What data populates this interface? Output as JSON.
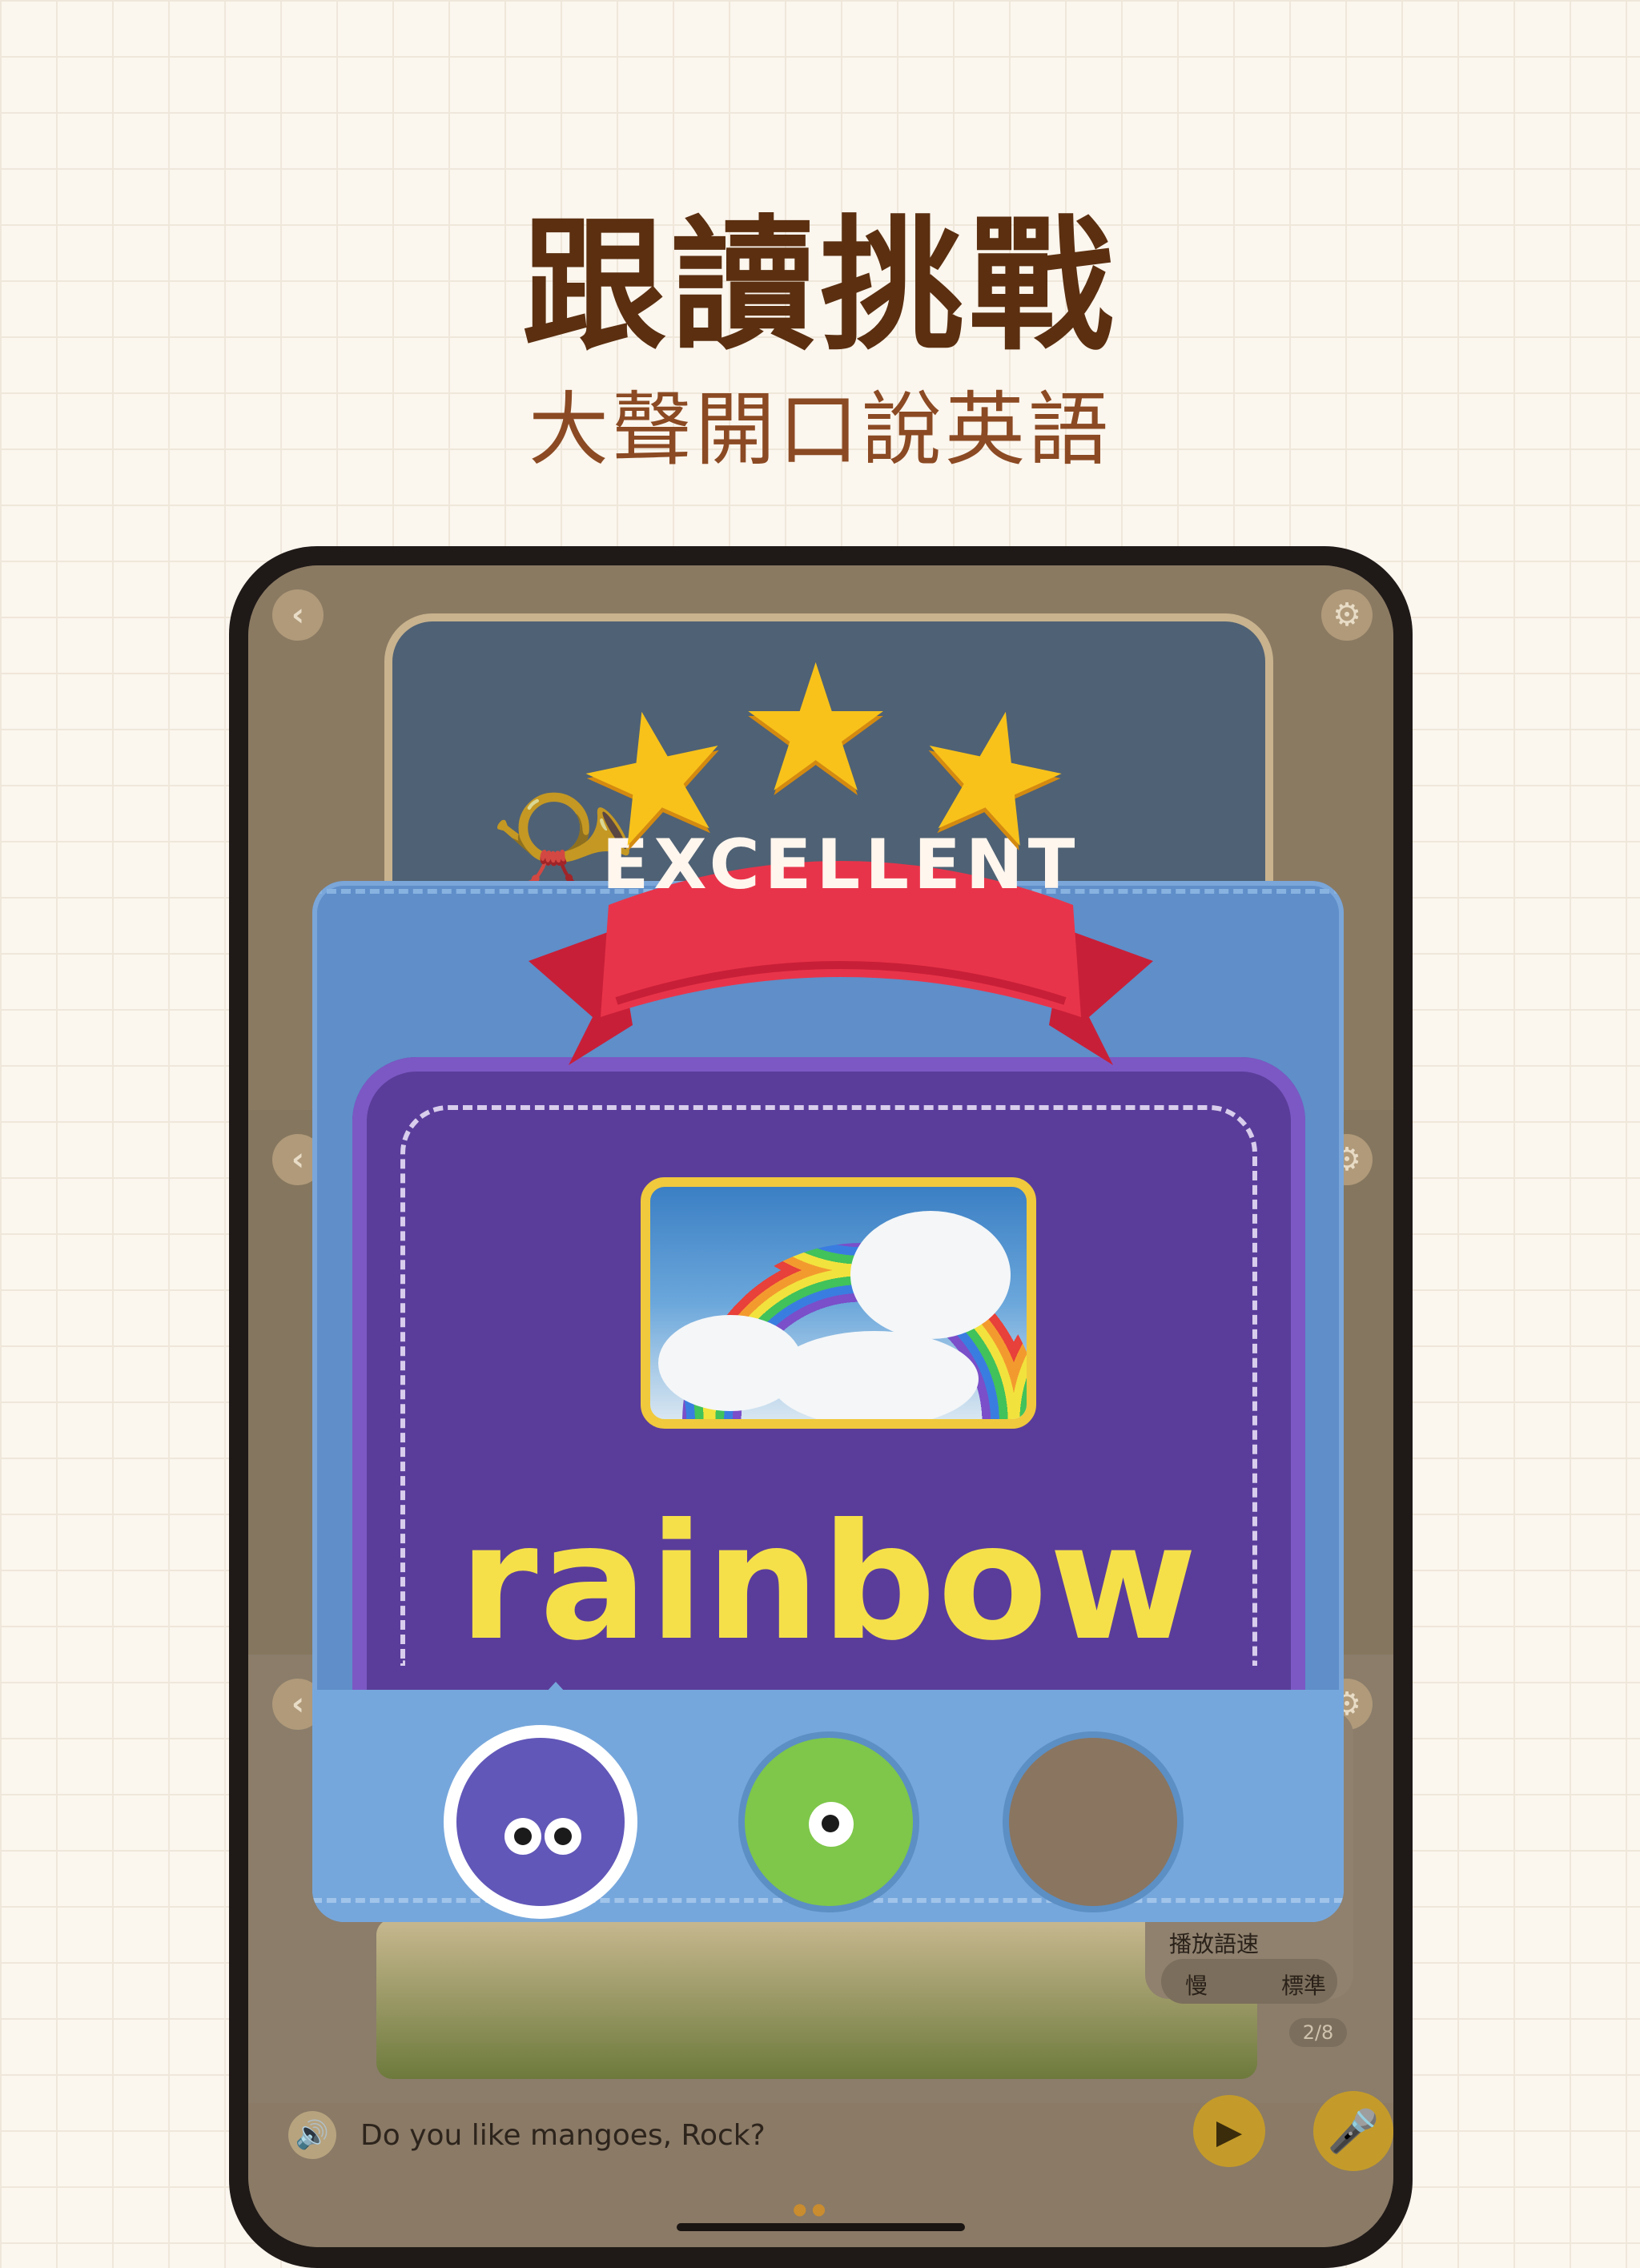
{
  "header": {
    "title": "跟讀挑戰",
    "subtitle": "大聲開口說英語"
  },
  "result": {
    "badge": "EXCELLENT",
    "star_count": 3,
    "word": "rainbow",
    "avatars": [
      "purple-ninja-avatar",
      "green-monster-avatar",
      "user-photo-avatar"
    ],
    "selected_avatar": 0
  },
  "player": {
    "sentence": "Do you like mangoes, Rock?",
    "speed_label": "播放語速",
    "speed_slow": "慢",
    "speed_normal": "標準",
    "page_indicator": "2/8"
  },
  "colors": {
    "title": "#5b2f10",
    "ribbon": "#e8344a",
    "card": "#5a3d9a",
    "word": "#f5e04a",
    "star": "#f8c21b"
  },
  "icons": {
    "back": "chevron-left-icon",
    "speaker": "speaker-icon",
    "mic": "microphone-icon",
    "play": "play-icon",
    "settings": "sliders-icon"
  }
}
